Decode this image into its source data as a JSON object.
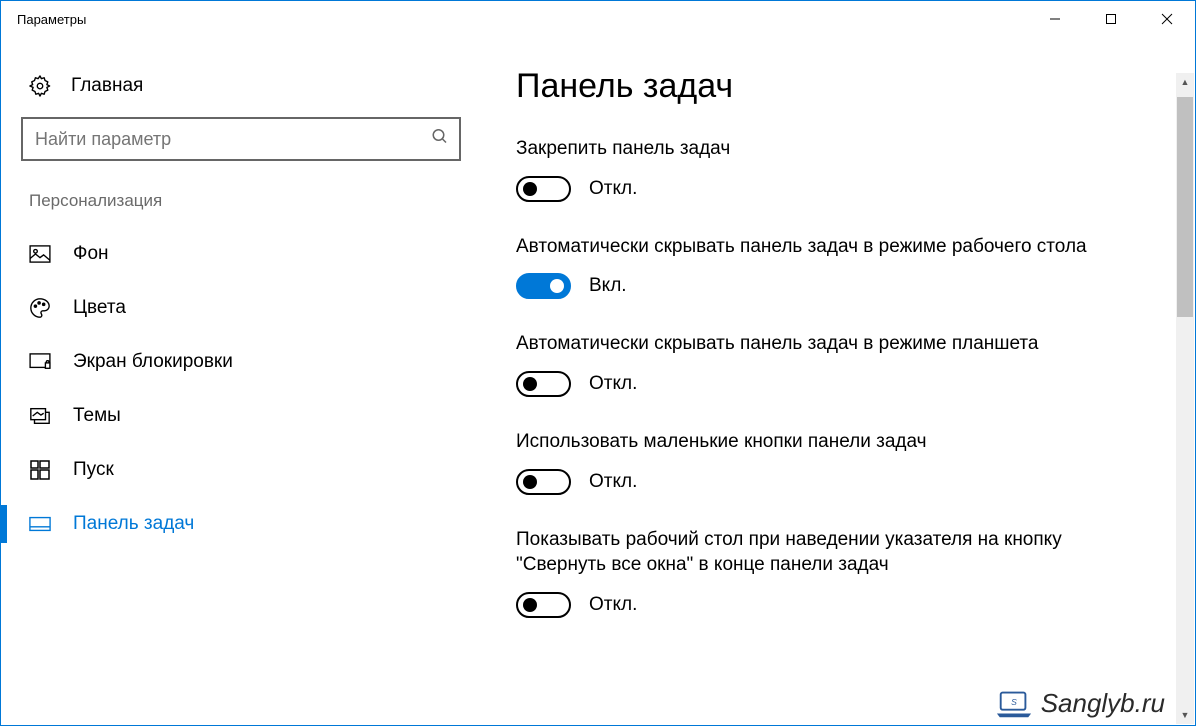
{
  "window": {
    "title": "Параметры"
  },
  "sidebar": {
    "home_label": "Главная",
    "search_placeholder": "Найти параметр",
    "section_label": "Персонализация",
    "items": [
      {
        "label": "Фон"
      },
      {
        "label": "Цвета"
      },
      {
        "label": "Экран блокировки"
      },
      {
        "label": "Темы"
      },
      {
        "label": "Пуск"
      },
      {
        "label": "Панель задач"
      }
    ]
  },
  "page": {
    "title": "Панель задач",
    "state_on": "Вкл.",
    "state_off": "Откл.",
    "settings": [
      {
        "label": "Закрепить панель задач",
        "on": false
      },
      {
        "label": "Автоматически скрывать панель задач в режиме рабочего стола",
        "on": true
      },
      {
        "label": "Автоматически скрывать панель задач в режиме планшета",
        "on": false
      },
      {
        "label": "Использовать маленькие кнопки панели задач",
        "on": false
      },
      {
        "label": "Показывать рабочий стол при наведении указателя на кнопку \"Свернуть все окна\" в конце панели задач",
        "on": false
      }
    ]
  },
  "watermark": "Sanglyb.ru"
}
